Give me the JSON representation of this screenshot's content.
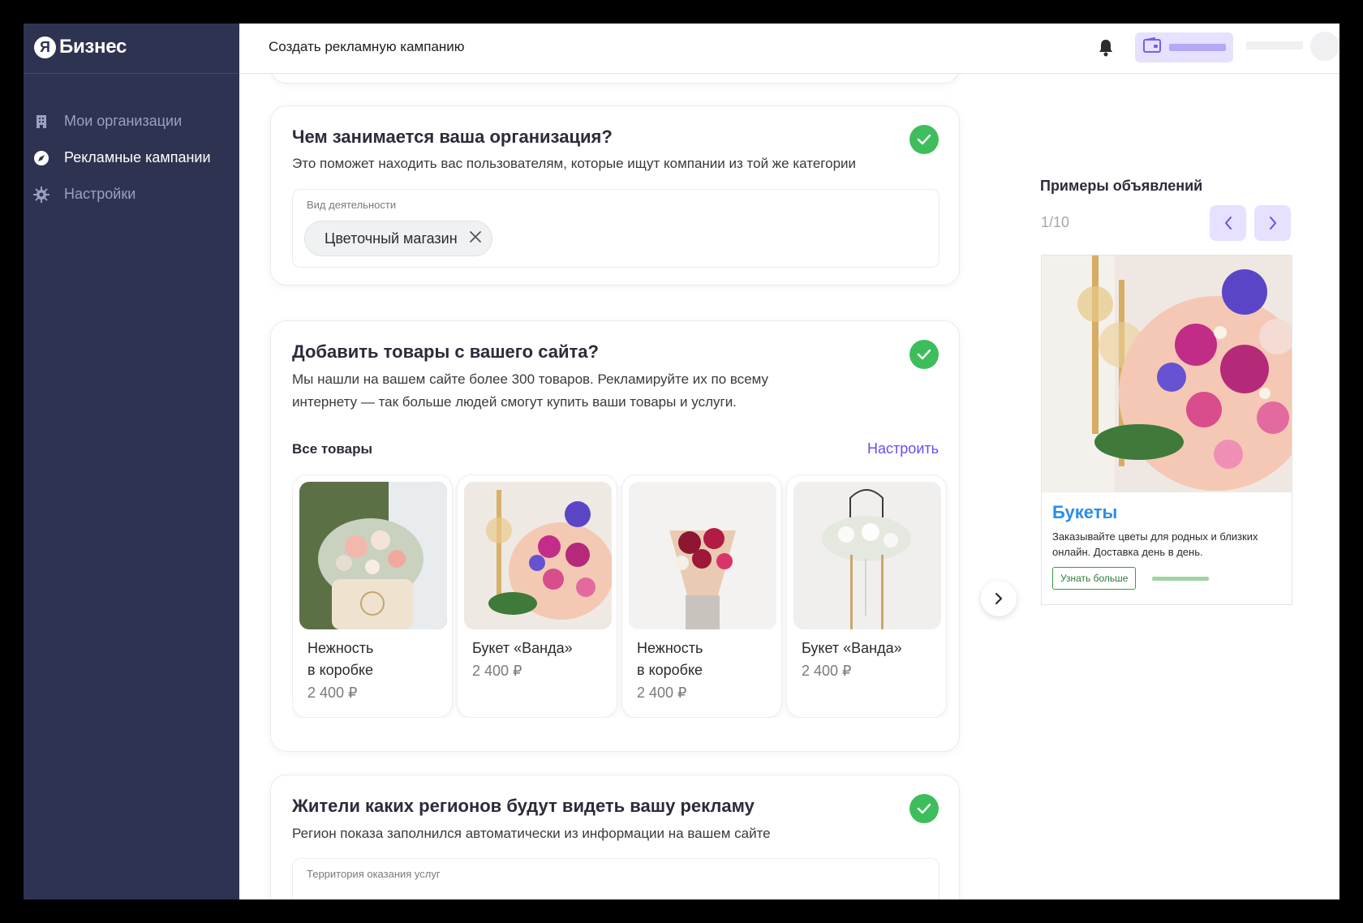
{
  "app": {
    "logo_mark": "Я",
    "logo_text": "Бизнес"
  },
  "sidebar": {
    "items": [
      {
        "label": "Мои организации",
        "icon": "building-icon",
        "active": false
      },
      {
        "label": "Рекламные кампании",
        "icon": "rocket-icon",
        "active": true
      },
      {
        "label": "Настройки",
        "icon": "gear-icon",
        "active": false
      }
    ]
  },
  "header": {
    "title": "Создать рекламную кампанию"
  },
  "activity_card": {
    "title": "Чем занимается ваша организация?",
    "description": "Это поможет находить вас пользователям, которые ищут компании из той же категории",
    "field_label": "Вид деятельности",
    "chip": "Цветочный магазин"
  },
  "products_card": {
    "title": "Добавить товары с вашего сайта?",
    "description": "Мы нашли на вашем сайте более 300 товаров. Рекламируйте их по всему интернету — так больше людей смогут купить ваши товары и услуги.",
    "section_title": "Все товары",
    "configure_link": "Настроить",
    "products": [
      {
        "name": "Нежность\nв коробке",
        "price": "2 400 ₽"
      },
      {
        "name": "Букет «Ванда»",
        "price": "2 400 ₽"
      },
      {
        "name": "Нежность\nв коробке",
        "price": "2 400 ₽"
      },
      {
        "name": "Букет «Ванда»",
        "price": "2 400 ₽"
      }
    ]
  },
  "region_card": {
    "title": "Жители каких регионов будут видеть вашу рекламу",
    "description": "Регион показа заполнился автоматически из информации на вашем сайте",
    "field_label": "Территория оказания услуг"
  },
  "examples": {
    "title": "Примеры объявлений",
    "counter": "1/10",
    "ad": {
      "title": "Букеты",
      "text": "Заказывайте цветы для родных и близких онлайн. Доставка день в день.",
      "button": "Узнать больше"
    }
  },
  "colors": {
    "sidebar_bg": "#2f3352",
    "accent": "#6b4cf0",
    "success": "#3ebd5c",
    "accent_light": "#e6e1ff"
  }
}
